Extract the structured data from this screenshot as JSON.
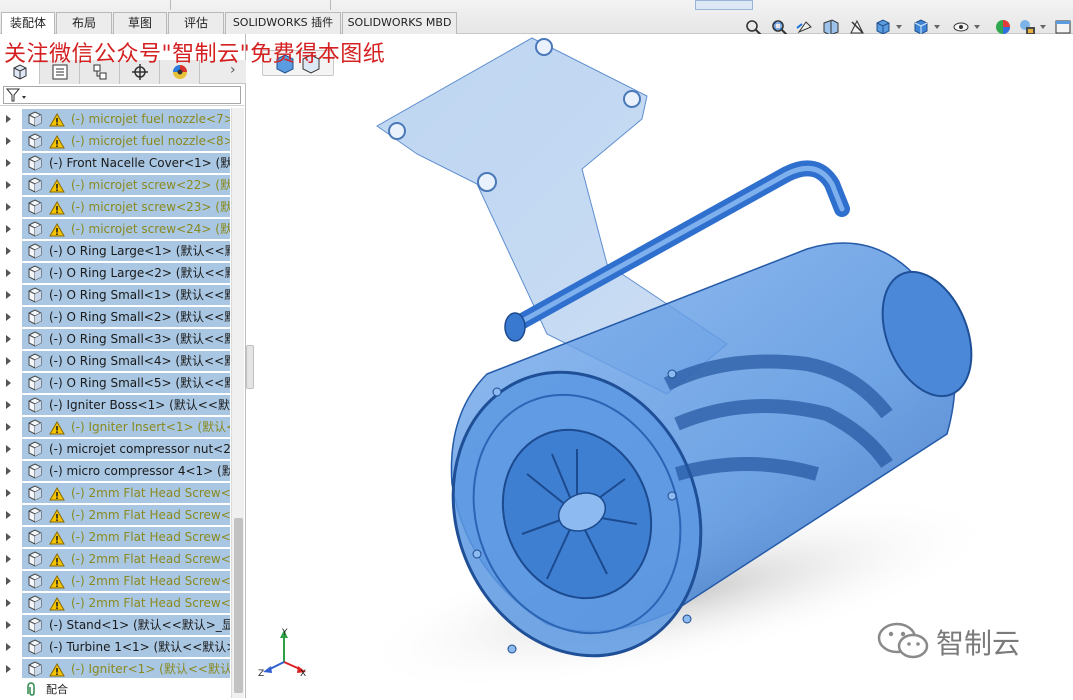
{
  "command_tabs": [
    {
      "label": "装配体",
      "active": true
    },
    {
      "label": "布局",
      "active": false
    },
    {
      "label": "草图",
      "active": false
    },
    {
      "label": "评估",
      "active": false
    },
    {
      "label": "SOLIDWORKS 插件",
      "active": false
    },
    {
      "label": "SOLIDWORKS MBD",
      "active": false
    }
  ],
  "watermark_text": "关注微信公众号\"智制云\"免费得本图纸",
  "feature_tree": {
    "items": [
      {
        "label": "(-) microjet fuel nozzle<7>",
        "warning": true
      },
      {
        "label": "(-) microjet fuel nozzle<8>",
        "warning": true
      },
      {
        "label": "(-) Front Nacelle Cover<1> (默认<",
        "warning": false
      },
      {
        "label": "(-) microjet screw<22> (默认<",
        "warning": true
      },
      {
        "label": "(-) microjet screw<23> (默认<",
        "warning": true
      },
      {
        "label": "(-) microjet screw<24> (默认<",
        "warning": true
      },
      {
        "label": "(-) O Ring Large<1> (默认<<默认",
        "warning": false
      },
      {
        "label": "(-) O Ring Large<2> (默认<<默认",
        "warning": false
      },
      {
        "label": "(-) O Ring Small<1> (默认<<默认",
        "warning": false
      },
      {
        "label": "(-) O Ring Small<2> (默认<<默认",
        "warning": false
      },
      {
        "label": "(-) O Ring Small<3> (默认<<默认",
        "warning": false
      },
      {
        "label": "(-) O Ring Small<4> (默认<<默认",
        "warning": false
      },
      {
        "label": "(-) O Ring Small<5> (默认<<默认",
        "warning": false
      },
      {
        "label": "(-) Igniter Boss<1> (默认<<默认",
        "warning": false
      },
      {
        "label": "(-) Igniter Insert<1> (默认<<",
        "warning": true
      },
      {
        "label": "(-) microjet compressor nut<2>",
        "warning": false
      },
      {
        "label": "(-) micro compressor 4<1> (默认",
        "warning": false
      },
      {
        "label": "(-) 2mm Flat Head Screw<1>",
        "warning": true
      },
      {
        "label": "(-) 2mm Flat Head Screw<2>",
        "warning": true
      },
      {
        "label": "(-) 2mm Flat Head Screw<3>",
        "warning": true
      },
      {
        "label": "(-) 2mm Flat Head Screw<4>",
        "warning": true
      },
      {
        "label": "(-) 2mm Flat Head Screw<5>",
        "warning": true
      },
      {
        "label": "(-) 2mm Flat Head Screw<6>",
        "warning": true
      },
      {
        "label": "(-) Stand<1> (默认<<默认>_显示",
        "warning": false
      },
      {
        "label": "(-) Turbine 1<1> (默认<<默认>_",
        "warning": false
      },
      {
        "label": "(-) Igniter<1> (默认<<默认>_",
        "warning": true
      }
    ],
    "mates_label": "配合"
  },
  "wechat_label": "智制云",
  "triad_labels": {
    "x": "X",
    "y": "Y",
    "z": "Z"
  },
  "colors": {
    "selection": "#a9c7e3",
    "warning_text": "#8a8a20",
    "watermark": "#d42020",
    "part_blue": "#3b7fd6"
  }
}
